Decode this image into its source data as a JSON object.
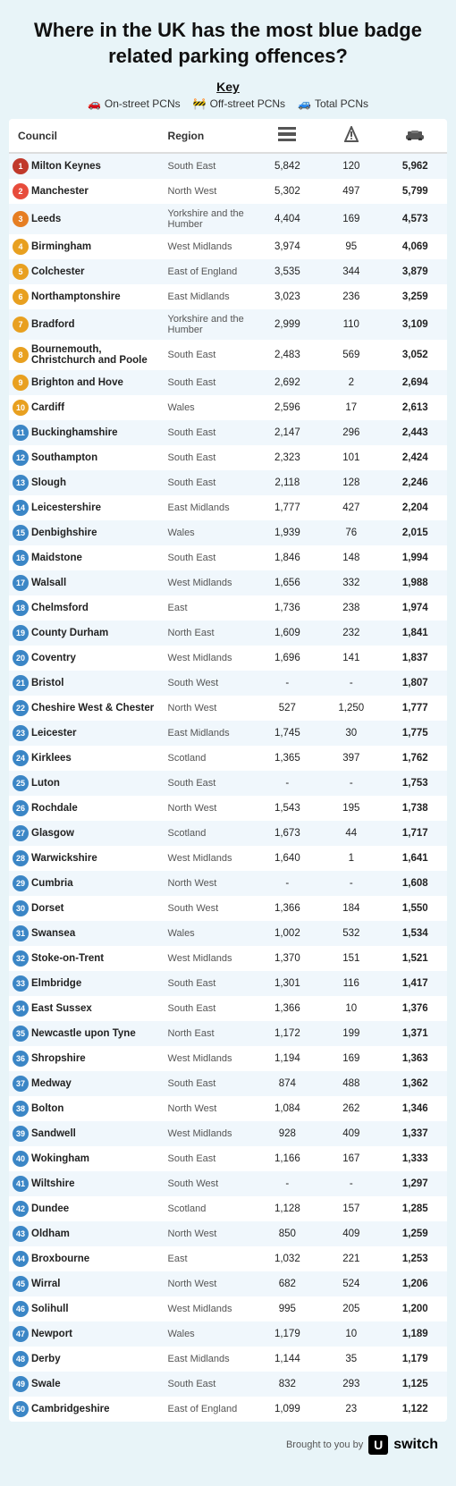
{
  "page": {
    "title": "Where in the UK has the most blue badge related parking offences?",
    "key": {
      "label": "Key",
      "items": [
        {
          "icon": "car-road-icon",
          "label": "On-street PCNs"
        },
        {
          "icon": "sign-icon",
          "label": "Off-street PCNs"
        },
        {
          "icon": "car-icon",
          "label": "Total PCNs"
        }
      ]
    },
    "table": {
      "headers": [
        "Council",
        "Region",
        "On-street PCNs",
        "Off-street PCNs",
        "Total PCNs"
      ],
      "rows": [
        {
          "rank": 1,
          "council": "Milton Keynes",
          "region": "South East",
          "on_street": "5,842",
          "off_street": "120",
          "total": "5,962"
        },
        {
          "rank": 2,
          "council": "Manchester",
          "region": "North West",
          "on_street": "5,302",
          "off_street": "497",
          "total": "5,799"
        },
        {
          "rank": 3,
          "council": "Leeds",
          "region": "Yorkshire and the Humber",
          "on_street": "4,404",
          "off_street": "169",
          "total": "4,573"
        },
        {
          "rank": 4,
          "council": "Birmingham",
          "region": "West Midlands",
          "on_street": "3,974",
          "off_street": "95",
          "total": "4,069"
        },
        {
          "rank": 5,
          "council": "Colchester",
          "region": "East of England",
          "on_street": "3,535",
          "off_street": "344",
          "total": "3,879"
        },
        {
          "rank": 6,
          "council": "Northamptonshire",
          "region": "East Midlands",
          "on_street": "3,023",
          "off_street": "236",
          "total": "3,259"
        },
        {
          "rank": 7,
          "council": "Bradford",
          "region": "Yorkshire and the Humber",
          "on_street": "2,999",
          "off_street": "110",
          "total": "3,109"
        },
        {
          "rank": 8,
          "council": "Bournemouth, Christchurch and Poole",
          "region": "South East",
          "on_street": "2,483",
          "off_street": "569",
          "total": "3,052"
        },
        {
          "rank": 9,
          "council": "Brighton and Hove",
          "region": "South East",
          "on_street": "2,692",
          "off_street": "2",
          "total": "2,694"
        },
        {
          "rank": 10,
          "council": "Cardiff",
          "region": "Wales",
          "on_street": "2,596",
          "off_street": "17",
          "total": "2,613"
        },
        {
          "rank": 11,
          "council": "Buckinghamshire",
          "region": "South East",
          "on_street": "2,147",
          "off_street": "296",
          "total": "2,443"
        },
        {
          "rank": 12,
          "council": "Southampton",
          "region": "South East",
          "on_street": "2,323",
          "off_street": "101",
          "total": "2,424"
        },
        {
          "rank": 13,
          "council": "Slough",
          "region": "South East",
          "on_street": "2,118",
          "off_street": "128",
          "total": "2,246"
        },
        {
          "rank": 14,
          "council": "Leicestershire",
          "region": "East Midlands",
          "on_street": "1,777",
          "off_street": "427",
          "total": "2,204"
        },
        {
          "rank": 15,
          "council": "Denbighshire",
          "region": "Wales",
          "on_street": "1,939",
          "off_street": "76",
          "total": "2,015"
        },
        {
          "rank": 16,
          "council": "Maidstone",
          "region": "South East",
          "on_street": "1,846",
          "off_street": "148",
          "total": "1,994"
        },
        {
          "rank": 17,
          "council": "Walsall",
          "region": "West Midlands",
          "on_street": "1,656",
          "off_street": "332",
          "total": "1,988"
        },
        {
          "rank": 18,
          "council": "Chelmsford",
          "region": "East",
          "on_street": "1,736",
          "off_street": "238",
          "total": "1,974"
        },
        {
          "rank": 19,
          "council": "County Durham",
          "region": "North East",
          "on_street": "1,609",
          "off_street": "232",
          "total": "1,841"
        },
        {
          "rank": 20,
          "council": "Coventry",
          "region": "West Midlands",
          "on_street": "1,696",
          "off_street": "141",
          "total": "1,837"
        },
        {
          "rank": 21,
          "council": "Bristol",
          "region": "South West",
          "on_street": "-",
          "off_street": "-",
          "total": "1,807"
        },
        {
          "rank": 22,
          "council": "Cheshire West & Chester",
          "region": "North West",
          "on_street": "527",
          "off_street": "1,250",
          "total": "1,777"
        },
        {
          "rank": 23,
          "council": "Leicester",
          "region": "East Midlands",
          "on_street": "1,745",
          "off_street": "30",
          "total": "1,775"
        },
        {
          "rank": 24,
          "council": "Kirklees",
          "region": "Scotland",
          "on_street": "1,365",
          "off_street": "397",
          "total": "1,762"
        },
        {
          "rank": 25,
          "council": "Luton",
          "region": "South East",
          "on_street": "-",
          "off_street": "-",
          "total": "1,753"
        },
        {
          "rank": 26,
          "council": "Rochdale",
          "region": "North West",
          "on_street": "1,543",
          "off_street": "195",
          "total": "1,738"
        },
        {
          "rank": 27,
          "council": "Glasgow",
          "region": "Scotland",
          "on_street": "1,673",
          "off_street": "44",
          "total": "1,717"
        },
        {
          "rank": 28,
          "council": "Warwickshire",
          "region": "West Midlands",
          "on_street": "1,640",
          "off_street": "1",
          "total": "1,641"
        },
        {
          "rank": 29,
          "council": "Cumbria",
          "region": "North West",
          "on_street": "-",
          "off_street": "-",
          "total": "1,608"
        },
        {
          "rank": 30,
          "council": "Dorset",
          "region": "South West",
          "on_street": "1,366",
          "off_street": "184",
          "total": "1,550"
        },
        {
          "rank": 31,
          "council": "Swansea",
          "region": "Wales",
          "on_street": "1,002",
          "off_street": "532",
          "total": "1,534"
        },
        {
          "rank": 32,
          "council": "Stoke-on-Trent",
          "region": "West Midlands",
          "on_street": "1,370",
          "off_street": "151",
          "total": "1,521"
        },
        {
          "rank": 33,
          "council": "Elmbridge",
          "region": "South East",
          "on_street": "1,301",
          "off_street": "116",
          "total": "1,417"
        },
        {
          "rank": 34,
          "council": "East Sussex",
          "region": "South East",
          "on_street": "1,366",
          "off_street": "10",
          "total": "1,376"
        },
        {
          "rank": 35,
          "council": "Newcastle upon Tyne",
          "region": "North East",
          "on_street": "1,172",
          "off_street": "199",
          "total": "1,371"
        },
        {
          "rank": 36,
          "council": "Shropshire",
          "region": "West Midlands",
          "on_street": "1,194",
          "off_street": "169",
          "total": "1,363"
        },
        {
          "rank": 37,
          "council": "Medway",
          "region": "South East",
          "on_street": "874",
          "off_street": "488",
          "total": "1,362"
        },
        {
          "rank": 38,
          "council": "Bolton",
          "region": "North West",
          "on_street": "1,084",
          "off_street": "262",
          "total": "1,346"
        },
        {
          "rank": 39,
          "council": "Sandwell",
          "region": "West Midlands",
          "on_street": "928",
          "off_street": "409",
          "total": "1,337"
        },
        {
          "rank": 40,
          "council": "Wokingham",
          "region": "South East",
          "on_street": "1,166",
          "off_street": "167",
          "total": "1,333"
        },
        {
          "rank": 41,
          "council": "Wiltshire",
          "region": "South West",
          "on_street": "-",
          "off_street": "-",
          "total": "1,297"
        },
        {
          "rank": 42,
          "council": "Dundee",
          "region": "Scotland",
          "on_street": "1,128",
          "off_street": "157",
          "total": "1,285"
        },
        {
          "rank": 43,
          "council": "Oldham",
          "region": "North West",
          "on_street": "850",
          "off_street": "409",
          "total": "1,259"
        },
        {
          "rank": 44,
          "council": "Broxbourne",
          "region": "East",
          "on_street": "1,032",
          "off_street": "221",
          "total": "1,253"
        },
        {
          "rank": 45,
          "council": "Wirral",
          "region": "North West",
          "on_street": "682",
          "off_street": "524",
          "total": "1,206"
        },
        {
          "rank": 46,
          "council": "Solihull",
          "region": "West Midlands",
          "on_street": "995",
          "off_street": "205",
          "total": "1,200"
        },
        {
          "rank": 47,
          "council": "Newport",
          "region": "Wales",
          "on_street": "1,179",
          "off_street": "10",
          "total": "1,189"
        },
        {
          "rank": 48,
          "council": "Derby",
          "region": "East Midlands",
          "on_street": "1,144",
          "off_street": "35",
          "total": "1,179"
        },
        {
          "rank": 49,
          "council": "Swale",
          "region": "South East",
          "on_street": "832",
          "off_street": "293",
          "total": "1,125"
        },
        {
          "rank": 50,
          "council": "Cambridgeshire",
          "region": "East of England",
          "on_street": "1,099",
          "off_street": "23",
          "total": "1,122"
        }
      ]
    },
    "footer": {
      "brought_by": "Brought to you by",
      "brand": "switch",
      "brand_prefix": "U"
    }
  }
}
